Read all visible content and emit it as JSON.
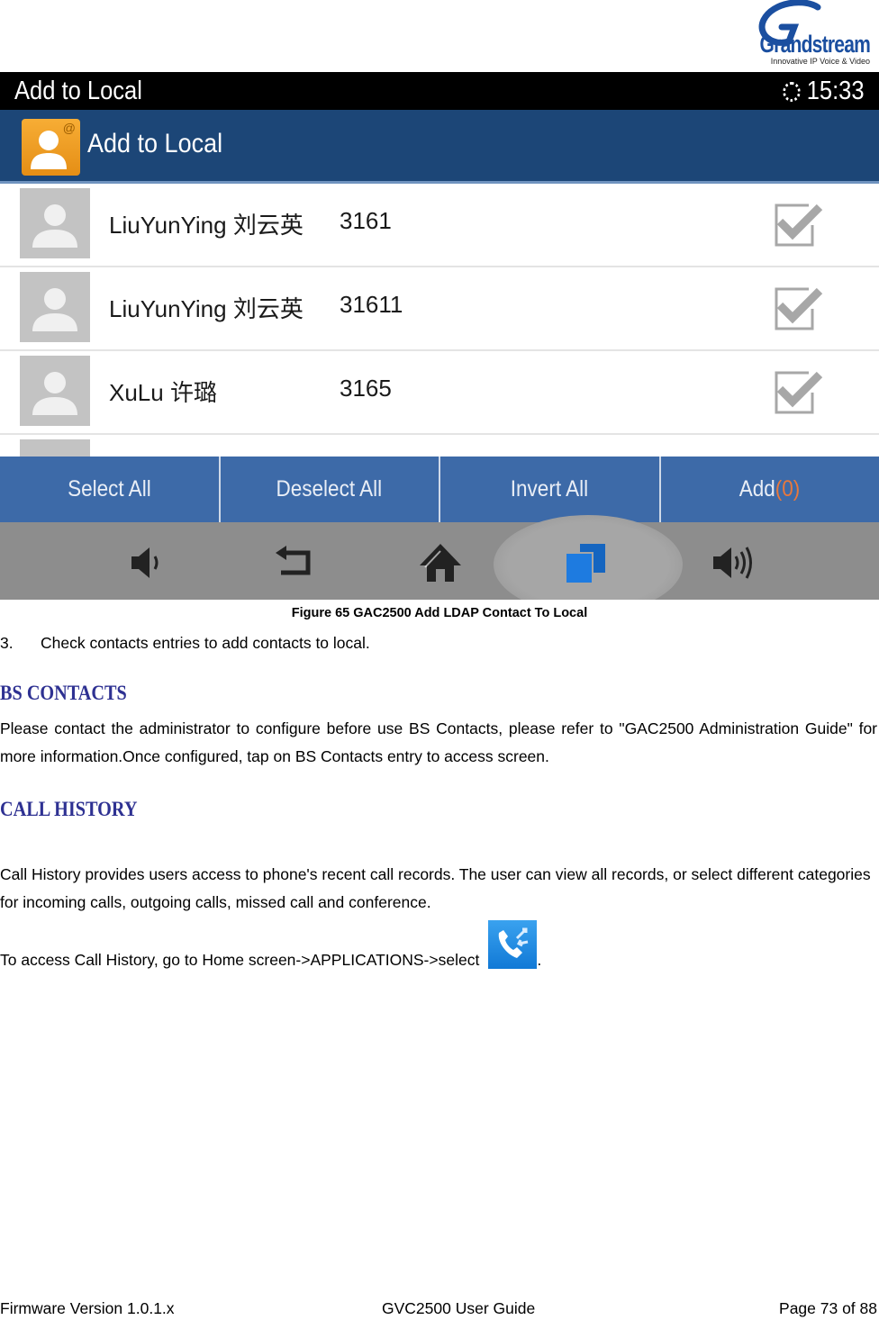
{
  "logo": {
    "brand": "Grandstream",
    "tagline": "Innovative IP Voice & Video"
  },
  "screen": {
    "status_bar": {
      "title": "Add to Local",
      "time": "15:33",
      "icon": "sync-icon"
    },
    "app_bar": {
      "icon": "contact-at-icon",
      "title": "Add to Local"
    },
    "contacts": [
      {
        "name": "LiuYunYing 刘云英",
        "number": "3161",
        "checked": false
      },
      {
        "name": "LiuYunYing 刘云英",
        "number": "31611",
        "checked": false
      },
      {
        "name": "XuLu 许璐",
        "number": "3165",
        "checked": false
      }
    ],
    "actions": {
      "select_all": "Select All",
      "deselect_all": "Deselect All",
      "invert_all": "Invert All",
      "add": "Add",
      "add_count": "(0)"
    },
    "nav_bar": [
      "volume-down-icon",
      "back-icon",
      "home-icon",
      "recent-apps-icon",
      "volume-up-icon"
    ],
    "colors": {
      "status_bar": "#000000",
      "app_bar": "#1c4677",
      "action_bar": "#3d6aa8",
      "nav_bar": "#8d8d8d",
      "add_count": "#e8783c"
    }
  },
  "document": {
    "caption": "Figure 65 GAC2500 Add LDAP Contact To Local",
    "step_number": "3.",
    "step_text": "Check contacts entries to add contacts to local.",
    "bs_heading": "BS CONTACTS",
    "bs_text": "Please contact the administrator to configure before use BS Contacts, please refer to \"GAC2500 Administration Guide\" for more information.Once configured, tap on BS Contacts entry to access screen.",
    "call_heading": "CALL HISTORY",
    "call_text": "Call History provides users access to phone's recent call records. The user can view all records, or select different categories for incoming calls, outgoing calls, missed call and conference.",
    "access_text": "To access Call History, go to Home screen->APPLICATIONS->select",
    "access_suffix": ".",
    "heading_color": "#2e3192"
  },
  "footer": {
    "firmware": "Firmware Version 1.0.1.x",
    "guide": "GVC2500 User Guide",
    "page": "Page 73 of 88"
  }
}
